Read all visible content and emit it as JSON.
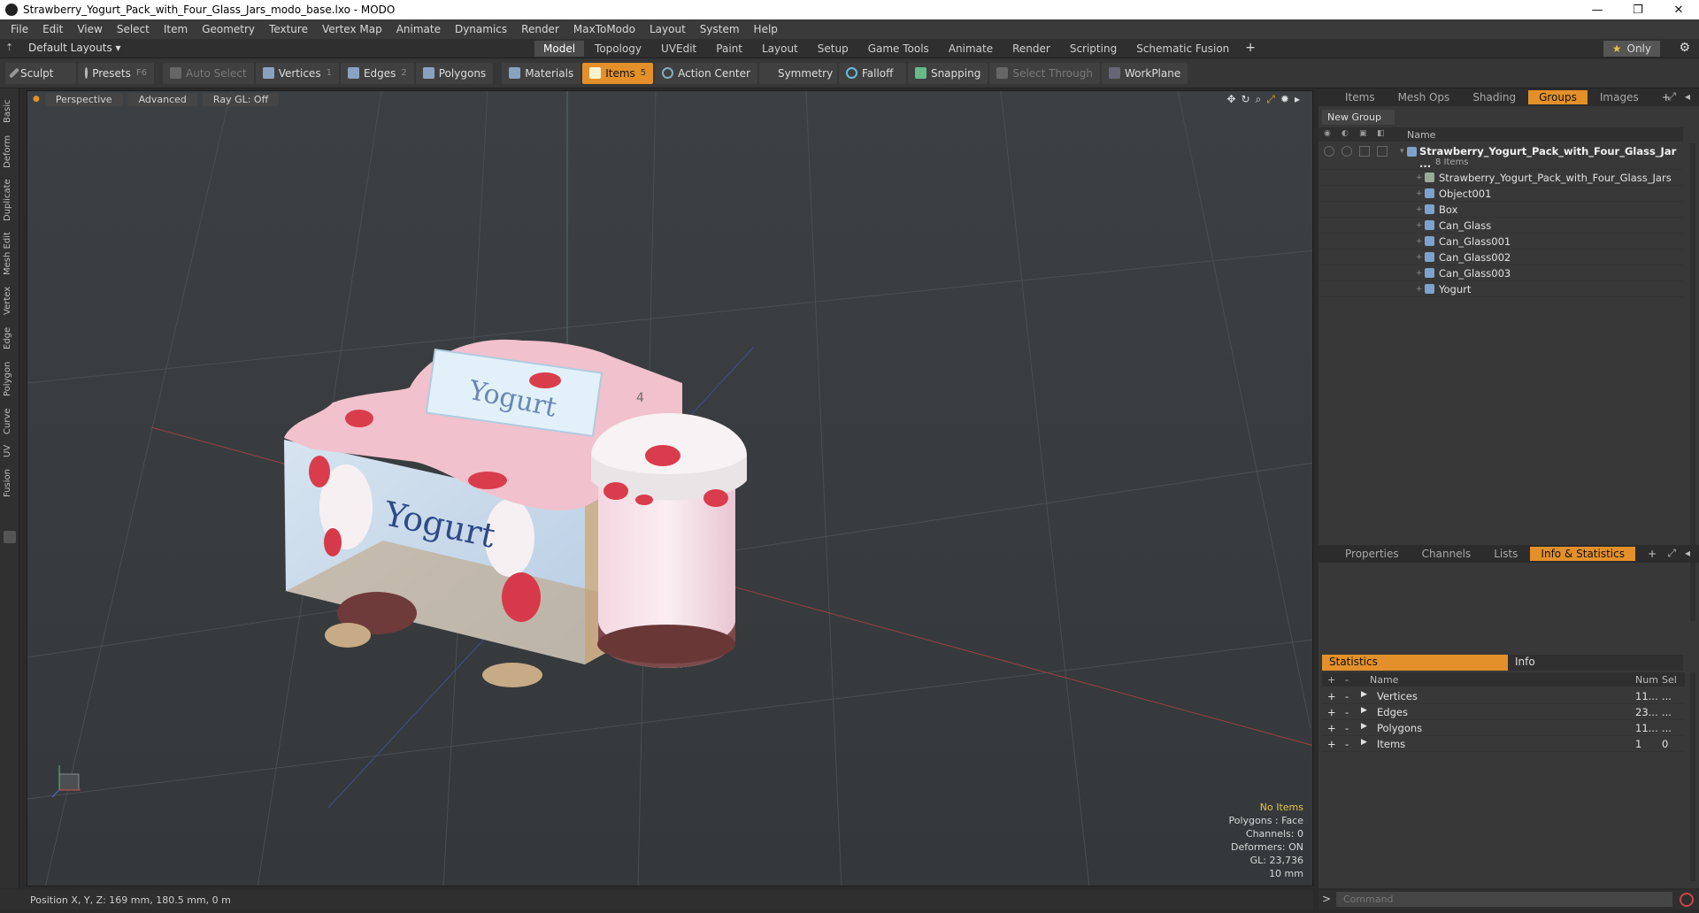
{
  "window": {
    "title": "Strawberry_Yogurt_Pack_with_Four_Glass_Jars_modo_base.lxo - MODO",
    "minimize": "—",
    "maximize": "❐",
    "close": "✕"
  },
  "menu": [
    "File",
    "Edit",
    "View",
    "Select",
    "Item",
    "Geometry",
    "Texture",
    "Vertex Map",
    "Animate",
    "Dynamics",
    "Render",
    "MaxToModo",
    "Layout",
    "System",
    "Help"
  ],
  "layoutbar": {
    "layout_dropdown": "Default Layouts ▾",
    "tabs": [
      "Model",
      "Topology",
      "UVEdit",
      "Paint",
      "Layout",
      "Setup",
      "Game Tools",
      "Animate",
      "Render",
      "Scripting",
      "Schematic Fusion"
    ],
    "active_tab": "Model",
    "only_label": "Only"
  },
  "toolbar": {
    "sculpt": "Sculpt",
    "presets": "Presets",
    "presets_key": "F6",
    "auto_select": "Auto Select",
    "vertices": "Vertices",
    "vertices_key": "1",
    "edges": "Edges",
    "edges_key": "2",
    "polygons": "Polygons",
    "materials": "Materials",
    "items": "Items",
    "items_key": "5",
    "action_center": "Action Center",
    "symmetry": "Symmetry",
    "falloff": "Falloff",
    "snapping": "Snapping",
    "select_through": "Select Through",
    "workplane": "WorkPlane"
  },
  "left_tabs": [
    "Basic",
    "Deform",
    "Duplicate",
    "Mesh Edit",
    "Vertex",
    "Edge",
    "Polygon",
    "Curve",
    "UV",
    "Fusion"
  ],
  "viewport": {
    "view_mode": "Perspective",
    "shading": "Advanced",
    "raygl": "Ray GL: Off",
    "product_label": "Yogurt",
    "lid_label": "Yogurt",
    "pack_number": "4",
    "stats": {
      "selection": "No Items",
      "polygons": "Polygons : Face",
      "channels": "Channels: 0",
      "deformers": "Deformers: ON",
      "gl": "GL: 23,736",
      "scale": "10 mm"
    }
  },
  "status": {
    "position": "Position X, Y, Z:   169 mm, 180.5 mm, 0 m"
  },
  "right_top_tabs": [
    "Items",
    "Mesh Ops",
    "Shading",
    "Groups",
    "Images"
  ],
  "right_top_active": "Groups",
  "groups": {
    "new_group": "New Group",
    "col_name": "Name",
    "root": "Strawberry_Yogurt_Pack_with_Four_Glass_Jar ...",
    "root_count": "8 Items",
    "items": [
      "Strawberry_Yogurt_Pack_with_Four_Glass_Jars",
      "Object001",
      "Box",
      "Can_Glass",
      "Can_Glass001",
      "Can_Glass002",
      "Can_Glass003",
      "Yogurt"
    ]
  },
  "right_bottom_tabs": [
    "Properties",
    "Channels",
    "Lists",
    "Info & Statistics"
  ],
  "right_bottom_active": "Info & Statistics",
  "stats_panel": {
    "tab_statistics": "Statistics",
    "tab_info": "Info",
    "col_name": "Name",
    "col_num": "Num",
    "col_sel": "Sel",
    "rows": [
      {
        "name": "Vertices",
        "num": "11...",
        "sel": "..."
      },
      {
        "name": "Edges",
        "num": "23...",
        "sel": "..."
      },
      {
        "name": "Polygons",
        "num": "11...",
        "sel": "..."
      },
      {
        "name": "Items",
        "num": "1",
        "sel": "0"
      }
    ]
  },
  "command": {
    "prompt": ">",
    "placeholder": "Command"
  }
}
